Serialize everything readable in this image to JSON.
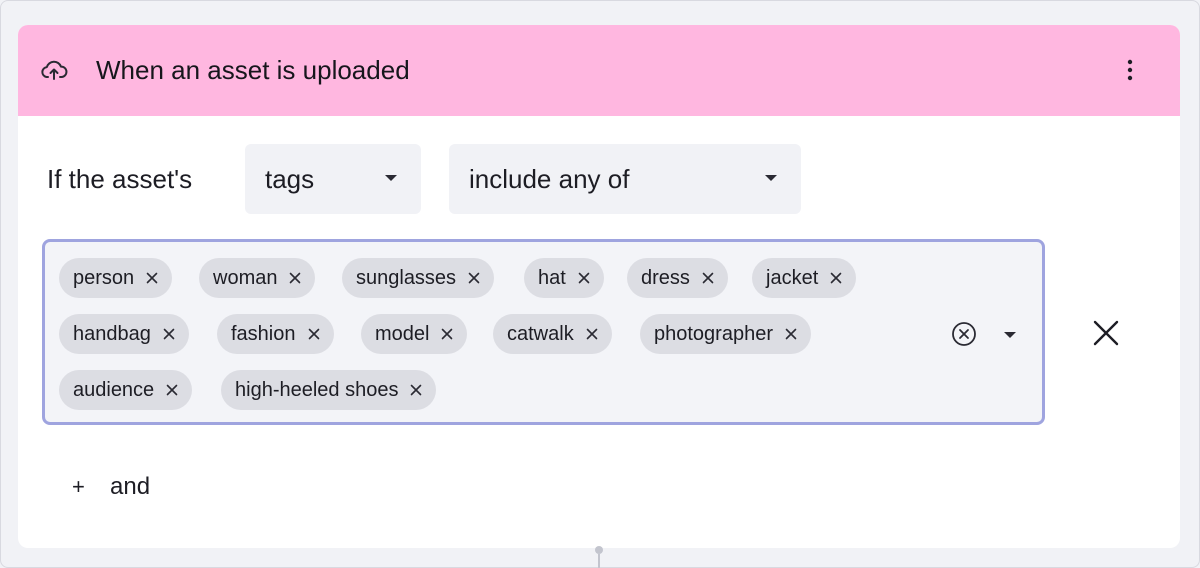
{
  "trigger": {
    "title": "When an asset is uploaded",
    "icon": "cloud-upload-icon",
    "header_color": "#ffb7e0",
    "menu_icon": "kebab-menu-icon"
  },
  "condition": {
    "prefix_label": "If the asset's",
    "field_select": {
      "value": "tags"
    },
    "operator_select": {
      "value": "include any of"
    },
    "tags": [
      "person",
      "woman",
      "sunglasses",
      "hat",
      "dress",
      "jacket",
      "handbag",
      "fashion",
      "model",
      "catwalk",
      "photographer",
      "audience",
      "high-heeled shoes"
    ],
    "focus_color": "#9fa4df"
  },
  "add_condition": {
    "label": "and",
    "icon": "plus-icon"
  }
}
